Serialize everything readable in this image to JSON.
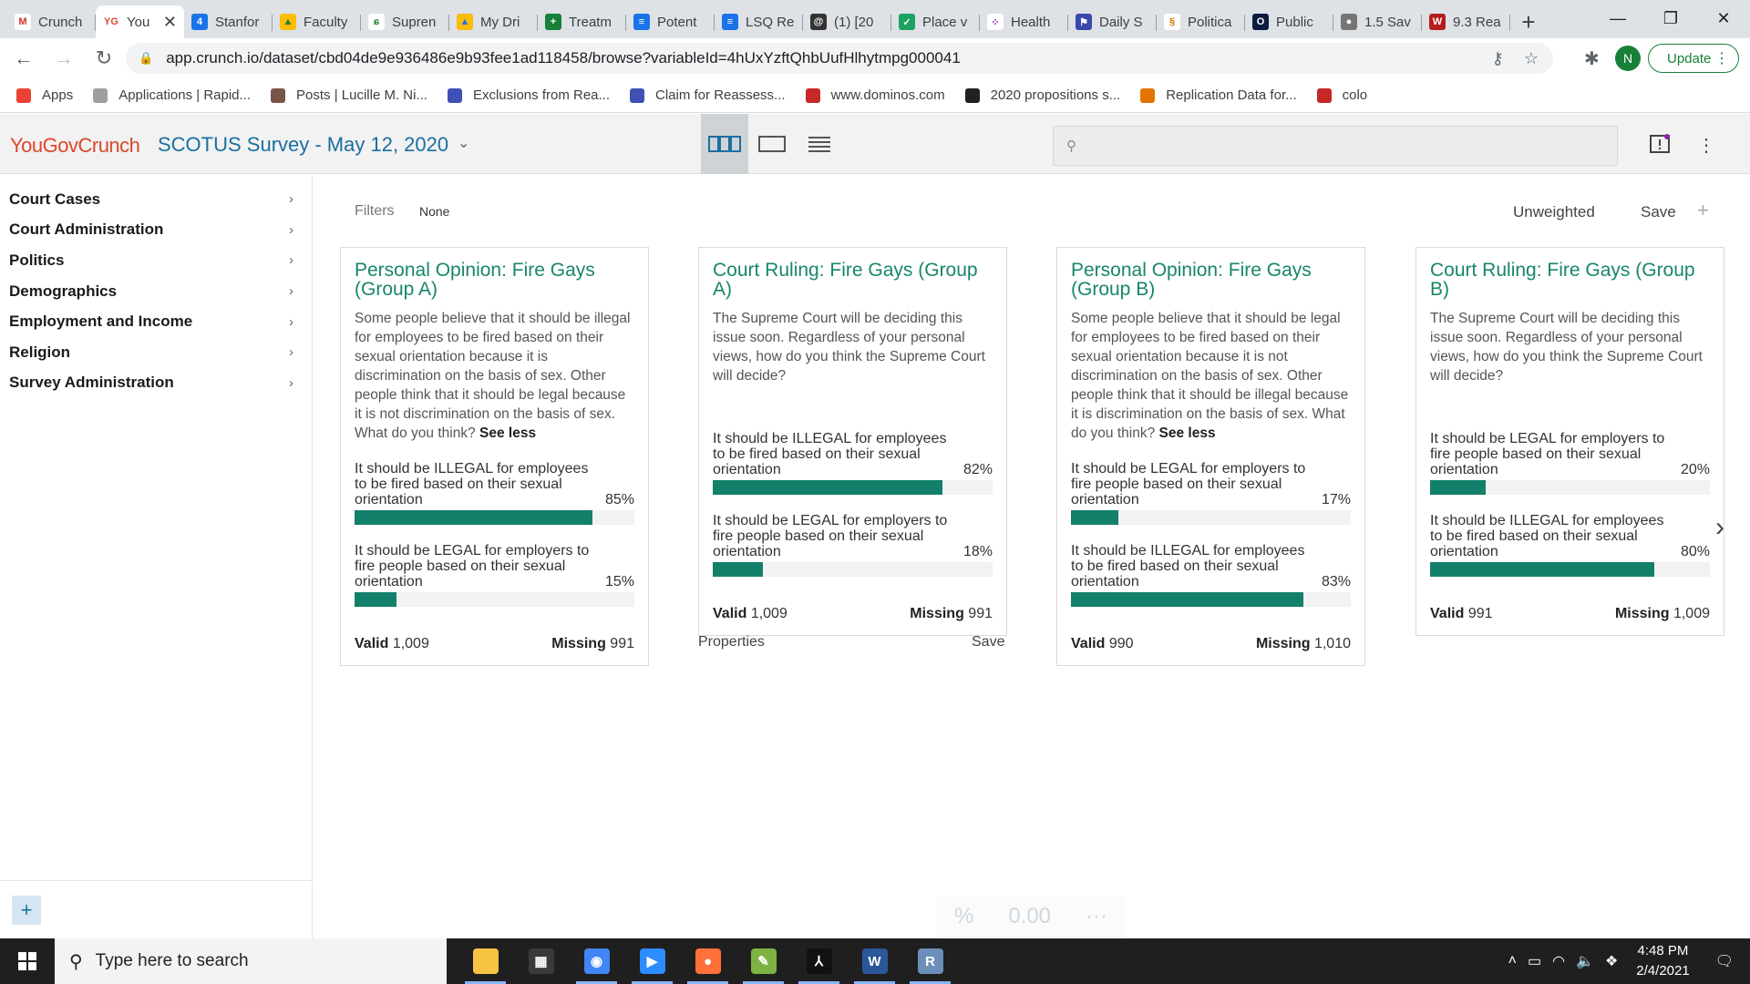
{
  "browser": {
    "tabs": [
      {
        "label": "Crunch",
        "color": "#ffffff",
        "glyph": "M",
        "glyph_color": "#d93025"
      },
      {
        "label": "You",
        "color": "#ffffff",
        "glyph": "YG",
        "glyph_color": "#d6492e",
        "active": true
      },
      {
        "label": "Stanfor",
        "color": "#1a73e8",
        "glyph": "4",
        "glyph_color": "#ffffff"
      },
      {
        "label": "Faculty",
        "color": "#fbbc04",
        "glyph": "▲",
        "glyph_color": "#188038"
      },
      {
        "label": "Supren",
        "color": "#ffffff",
        "glyph": "ɕ",
        "glyph_color": "#188038"
      },
      {
        "label": "My Dri",
        "color": "#fbbc04",
        "glyph": "▲",
        "glyph_color": "#1a73e8"
      },
      {
        "label": "Treatm",
        "color": "#188038",
        "glyph": "+",
        "glyph_color": "#ffffff"
      },
      {
        "label": "Potent",
        "color": "#1a73e8",
        "glyph": "≡",
        "glyph_color": "#ffffff"
      },
      {
        "label": "LSQ Re",
        "color": "#1a73e8",
        "glyph": "≡",
        "glyph_color": "#ffffff"
      },
      {
        "label": "(1) [20",
        "color": "#333333",
        "glyph": "@",
        "glyph_color": "#ffffff"
      },
      {
        "label": "Place v",
        "color": "#1aa260",
        "glyph": "✓",
        "glyph_color": "#ffffff"
      },
      {
        "label": "Health",
        "color": "#ffffff",
        "glyph": "⁘",
        "glyph_color": "#8e24aa"
      },
      {
        "label": "Daily S",
        "color": "#3949ab",
        "glyph": "⚑",
        "glyph_color": "#ffffff"
      },
      {
        "label": "Politica",
        "color": "#ffffff",
        "glyph": "§",
        "glyph_color": "#e37400"
      },
      {
        "label": "Public",
        "color": "#0d1b3e",
        "glyph": "O",
        "glyph_color": "#ffffff"
      },
      {
        "label": "1.5 Sav",
        "color": "#757575",
        "glyph": "●",
        "glyph_color": "#ffffff"
      },
      {
        "label": "9.3 Rea",
        "color": "#b71c1c",
        "glyph": "W",
        "glyph_color": "#ffffff"
      }
    ],
    "url": "app.crunch.io/dataset/cbd04de9e936486e9b93fee1ad118458/browse?variableId=4hUxYzftQhbUufHlhytmpg000041",
    "profile_initial": "N",
    "update_label": "Update",
    "bookmarks": [
      {
        "label": "Apps",
        "color": "#ea4335"
      },
      {
        "label": "Applications | Rapid...",
        "color": "#9e9e9e"
      },
      {
        "label": "Posts | Lucille M. Ni...",
        "color": "#795548"
      },
      {
        "label": "Exclusions from Rea...",
        "color": "#3f51b5"
      },
      {
        "label": "Claim for Reassess...",
        "color": "#3f51b5"
      },
      {
        "label": "www.dominos.com",
        "color": "#c62828"
      },
      {
        "label": "2020 propositions s...",
        "color": "#212121"
      },
      {
        "label": "Replication Data for...",
        "color": "#e37400"
      },
      {
        "label": "colo",
        "color": "#c62828"
      }
    ]
  },
  "app": {
    "logo_part1": "YouGov",
    "logo_part2": "Crunch",
    "dataset_title": "SCOTUS Survey - May 12, 2020",
    "accent": "#12806a",
    "title_color": "#1a6fa0"
  },
  "sidebar": {
    "items": [
      {
        "label": "Court Cases"
      },
      {
        "label": "Court Administration"
      },
      {
        "label": "Politics"
      },
      {
        "label": "Demographics"
      },
      {
        "label": "Employment and Income"
      },
      {
        "label": "Religion"
      },
      {
        "label": "Survey Administration"
      }
    ]
  },
  "toolbar": {
    "filters_label": "Filters",
    "filters_value": "None",
    "weighting": "Unweighted",
    "save_label": "Save"
  },
  "cards": [
    {
      "title": "Personal Opinion: Fire Gays (Group A)",
      "question": "Some people believe that it should be illegal for employees to be fired based on their sexual orientation because it is discrimination on the basis of sex. Other people think that it should be legal because it is not discrimination on the basis of sex.      What do you think?",
      "see_less": "See less",
      "responses": [
        {
          "label": "It should be ILLEGAL for employees to be fired based on their sexual orientation",
          "pct_label": "85%",
          "pct": 85
        },
        {
          "label": "It should be LEGAL for employers to fire people based on their sexual orientation",
          "pct_label": "15%",
          "pct": 15
        }
      ],
      "valid_label": "Valid",
      "valid": "1,009",
      "missing_label": "Missing",
      "missing": "991"
    },
    {
      "title": "Court Ruling: Fire Gays (Group A)",
      "question": "The Supreme Court will be deciding this issue soon. Regardless of your personal views, how do you think the Supreme Court will decide?",
      "see_less": "",
      "responses": [
        {
          "label": "It should be ILLEGAL for employees to be fired based on their sexual orientation",
          "pct_label": "82%",
          "pct": 82
        },
        {
          "label": "It should be LEGAL for employers to fire people based on their sexual orientation",
          "pct_label": "18%",
          "pct": 18
        }
      ],
      "valid_label": "Valid",
      "valid": "1,009",
      "missing_label": "Missing",
      "missing": "991",
      "properties_label": "Properties",
      "save_label": "Save"
    },
    {
      "title": "Personal Opinion: Fire Gays (Group B)",
      "question": "Some people believe that it should be legal for employees to be fired based on their sexual orientation because it is not discrimination on the basis of sex. Other people think that it should be illegal because it is discrimination on the basis of sex.      What do you think?",
      "see_less": "See less",
      "responses": [
        {
          "label": "It should be LEGAL for employers to fire people based on their sexual orientation",
          "pct_label": "17%",
          "pct": 17
        },
        {
          "label": "It should be ILLEGAL for employees to be fired based on their sexual orientation",
          "pct_label": "83%",
          "pct": 83
        }
      ],
      "valid_label": "Valid",
      "valid": "990",
      "missing_label": "Missing",
      "missing": "1,010"
    },
    {
      "title": "Court Ruling: Fire Gays (Group B)",
      "question": "The Supreme Court will be deciding this issue soon. Regardless of your personal views, how do you think the Supreme Court will decide?",
      "see_less": "",
      "responses": [
        {
          "label": "It should be LEGAL for employers to fire people based on their sexual orientation",
          "pct_label": "20%",
          "pct": 20
        },
        {
          "label": "It should be ILLEGAL for employees to be fired based on their sexual orientation",
          "pct_label": "80%",
          "pct": 80
        }
      ],
      "valid_label": "Valid",
      "valid": "991",
      "missing_label": "Missing",
      "missing": "1,009"
    }
  ],
  "bottom_ghost": {
    "pct_symbol": "%",
    "decimals": "0.00",
    "more": "···"
  },
  "taskbar": {
    "search_placeholder": "Type here to search",
    "time": "4:48 PM",
    "date": "2/4/2021",
    "apps": [
      {
        "name": "file-explorer",
        "color": "#f6c343",
        "glyph": "",
        "open": true
      },
      {
        "name": "task-view",
        "color": "#3a3a3a",
        "glyph": "▦",
        "open": false
      },
      {
        "name": "chrome",
        "color": "#4285f4",
        "glyph": "◉",
        "open": true
      },
      {
        "name": "zoom",
        "color": "#2d8cff",
        "glyph": "▶",
        "open": true
      },
      {
        "name": "firefox",
        "color": "#ff7139",
        "glyph": "●",
        "open": true
      },
      {
        "name": "sheets",
        "color": "#7cb342",
        "glyph": "✎",
        "open": true
      },
      {
        "name": "acrobat",
        "color": "#111111",
        "glyph": "⅄",
        "open": true
      },
      {
        "name": "word",
        "color": "#2b579a",
        "glyph": "W",
        "open": true
      },
      {
        "name": "r",
        "color": "#6b8fb8",
        "glyph": "R",
        "open": true
      }
    ]
  }
}
